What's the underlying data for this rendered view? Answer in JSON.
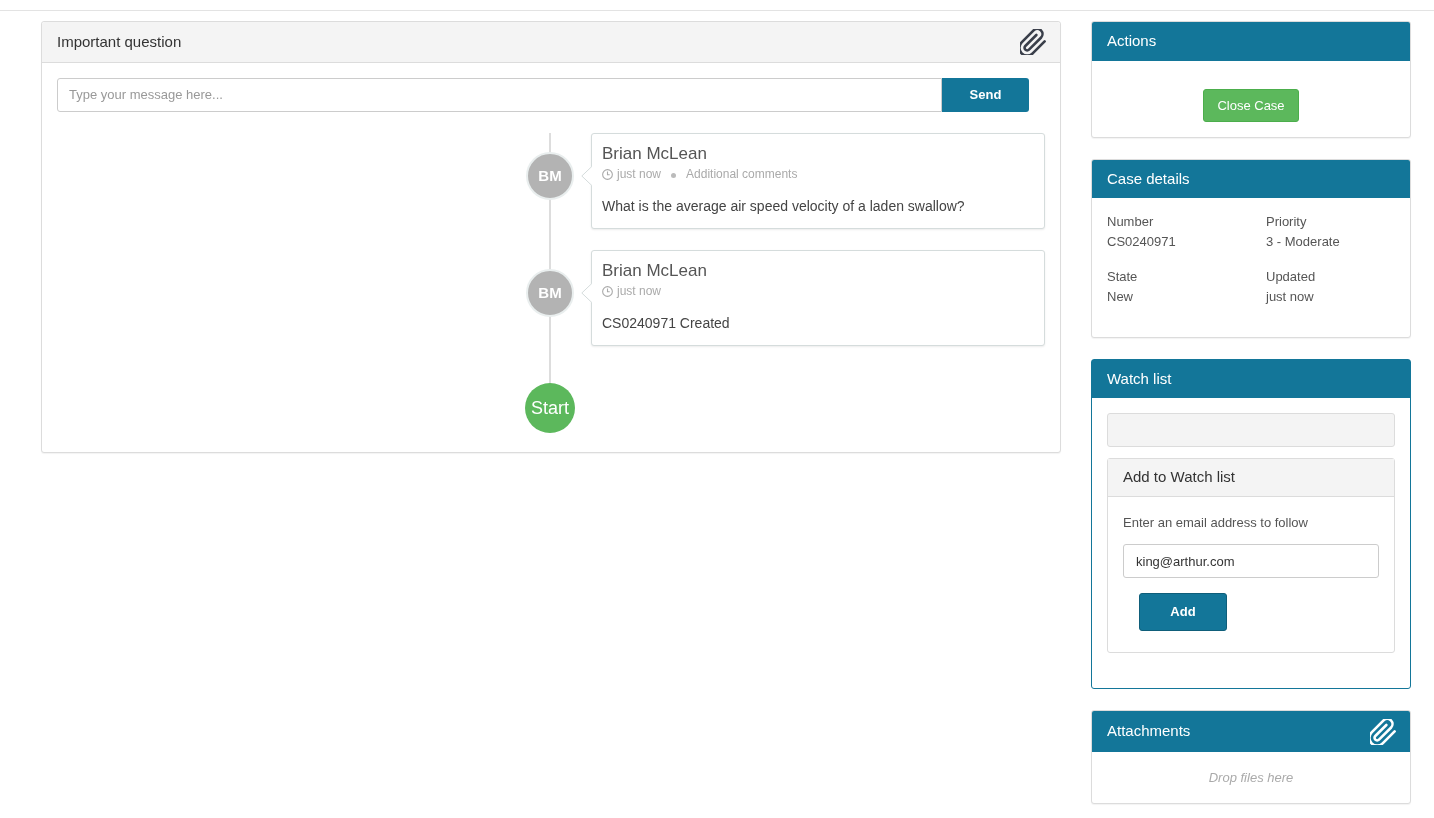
{
  "conversation": {
    "title": "Important question",
    "message_input": {
      "placeholder": "Type your message here..."
    },
    "send_button": "Send",
    "entries": [
      {
        "author": "Brian McLean",
        "initials": "BM",
        "time": "just now",
        "type_label": "Additional comments",
        "text": "What is the average air speed velocity of a laden swallow?"
      },
      {
        "author": "Brian McLean",
        "initials": "BM",
        "time": "just now",
        "text": "CS0240971 Created"
      }
    ],
    "start_label": "Start"
  },
  "actions": {
    "title": "Actions",
    "buttons": [
      "Close Case"
    ]
  },
  "case_details": {
    "title": "Case details",
    "fields": [
      {
        "label": "Number",
        "value": "CS0240971"
      },
      {
        "label": "Priority",
        "value": "3 - Moderate"
      },
      {
        "label": "State",
        "value": "New"
      },
      {
        "label": "Updated",
        "value": "just now"
      }
    ]
  },
  "watch_list": {
    "title": "Watch list",
    "add_panel": {
      "title": "Add to Watch list",
      "prompt": "Enter an email address to follow",
      "email_input": {
        "value": "king@arthur.com"
      },
      "add_button": "Add"
    }
  },
  "attachments": {
    "title": "Attachments",
    "drop_hint": "Drop files here"
  }
}
